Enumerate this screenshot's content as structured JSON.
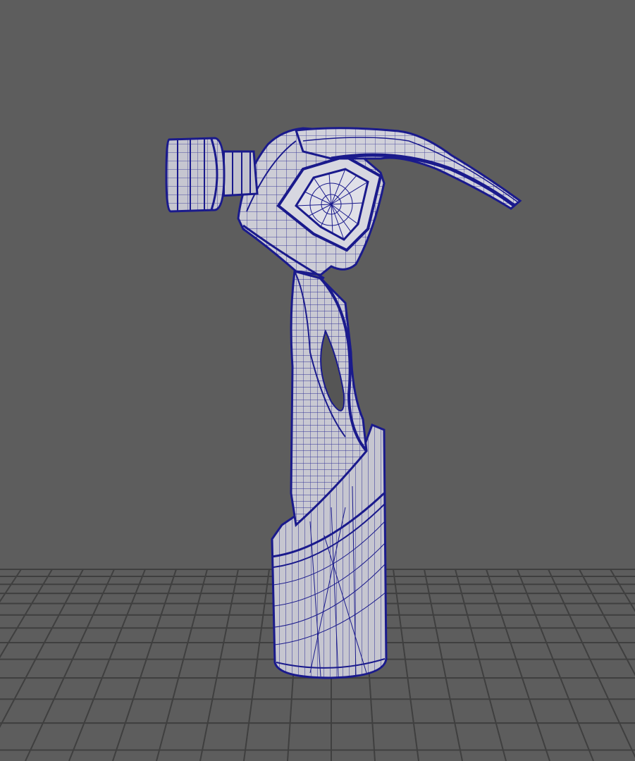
{
  "viewport": {
    "background": "#5d5d5d",
    "grid_color": "#3f3f3f",
    "mesh_fill": "#c9c9d2",
    "mesh_fill_shadow": "#a8a8b4",
    "wire_color": "#1a1a8c",
    "grid_visible": true,
    "display_mode": "wireframe-on-shaded"
  },
  "model": {
    "object": "hammer-mesh",
    "parts": [
      "hammer-head-cap",
      "hammer-neck",
      "hammer-head-body",
      "hammer-claw",
      "hammer-eye",
      "hammer-shaft",
      "hammer-grip"
    ]
  }
}
